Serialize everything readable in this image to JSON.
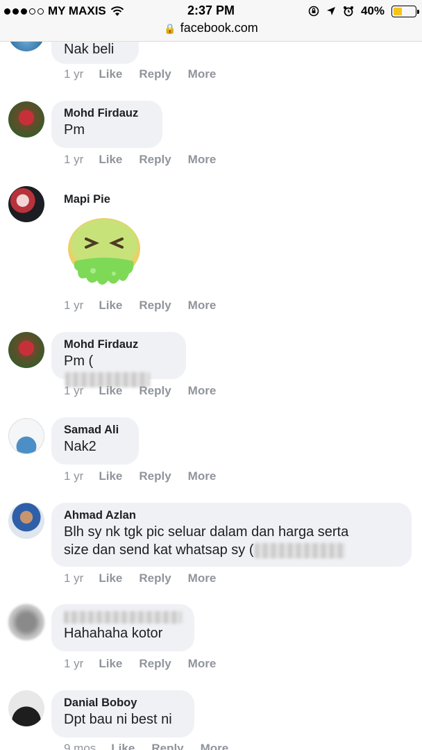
{
  "status_bar": {
    "carrier": "MY MAXIS",
    "time": "2:37 PM",
    "battery": "40%",
    "battery_level": 0.4,
    "url": "facebook.com"
  },
  "actions": {
    "like": "Like",
    "reply": "Reply",
    "more": "More"
  },
  "comments": [
    {
      "author": "",
      "text": "Nak beli",
      "time": "1 yr"
    },
    {
      "author": "Mohd Firdauz",
      "text": "Pm",
      "time": "1 yr"
    },
    {
      "author": "Mapi Pie",
      "text": "",
      "time": "1 yr",
      "sticker": "sick-face-sticker"
    },
    {
      "author": "Mohd Firdauz",
      "text": "Pm (",
      "time": "1 yr"
    },
    {
      "author": "Samad Ali",
      "text": "Nak2",
      "time": "1 yr"
    },
    {
      "author": "Ahmad Azlan",
      "text_line1": "Blh sy nk tgk pic seluar dalam dan harga serta",
      "text_line2": "size dan send kat whatsap sy (",
      "time": "1 yr"
    },
    {
      "author": "",
      "text": "Hahahaha kotor",
      "time": "1 yr"
    },
    {
      "author": "Danial Boboy",
      "text": "Dpt bau ni best ni",
      "time": "9 mos"
    }
  ]
}
